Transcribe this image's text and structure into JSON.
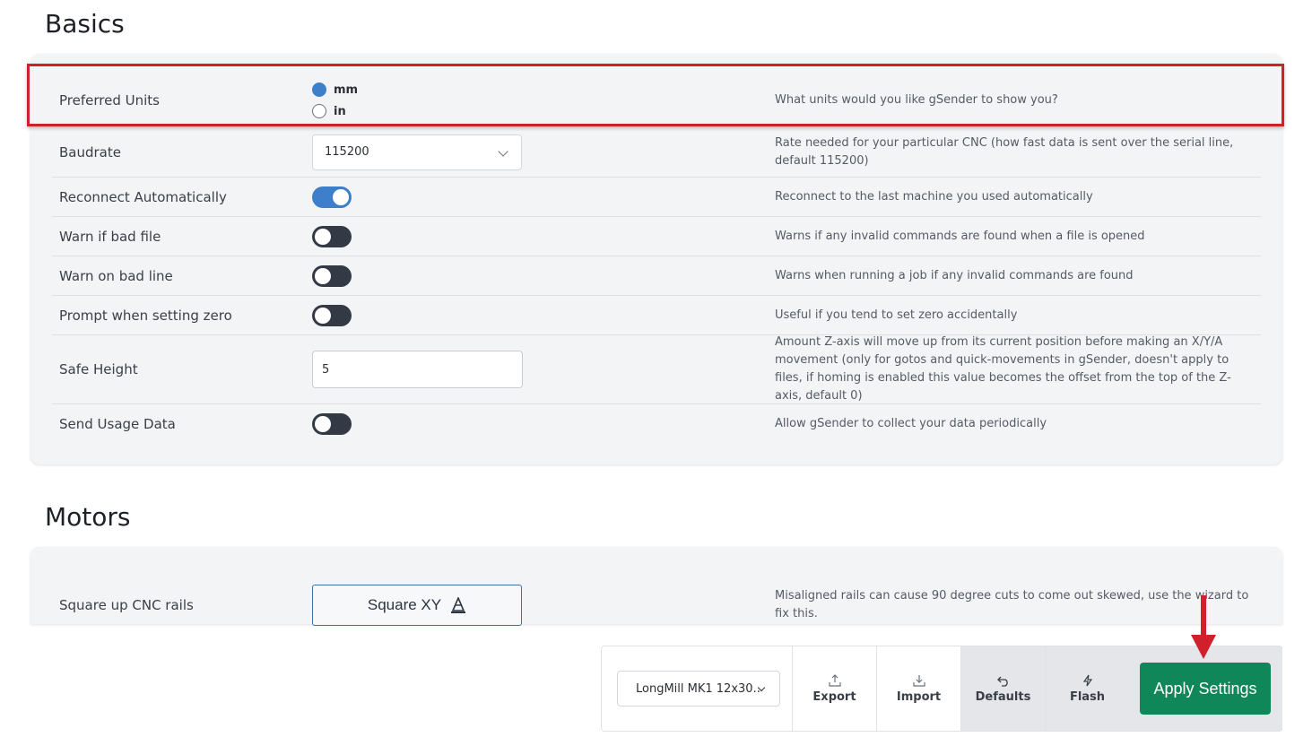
{
  "sections": {
    "basics_title": "Basics",
    "motors_title": "Motors"
  },
  "basics": {
    "preferred_units": {
      "label": "Preferred Units",
      "options": [
        "mm",
        "in"
      ],
      "selected": "mm",
      "description": "What units would you like gSender to show you?"
    },
    "baudrate": {
      "label": "Baudrate",
      "value": "115200",
      "description": "Rate needed for your particular CNC (how fast data is sent over the serial line, default 115200)"
    },
    "reconnect": {
      "label": "Reconnect Automatically",
      "on": true,
      "description": "Reconnect to the last machine you used automatically"
    },
    "warn_bad_file": {
      "label": "Warn if bad file",
      "on": false,
      "description": "Warns if any invalid commands are found when a file is opened"
    },
    "warn_bad_line": {
      "label": "Warn on bad line",
      "on": false,
      "description": "Warns when running a job if any invalid commands are found"
    },
    "prompt_zero": {
      "label": "Prompt when setting zero",
      "on": false,
      "description": "Useful if you tend to set zero accidentally"
    },
    "safe_height": {
      "label": "Safe Height",
      "value": "5",
      "description": "Amount Z-axis will move up from its current position before making an X/Y/A movement (only for gotos and quick-movements in gSender, doesn't apply to files, if homing is enabled this value becomes the offset from the top of the Z-axis, default 0)"
    },
    "usage_data": {
      "label": "Send Usage Data",
      "on": false,
      "description": "Allow gSender to collect your data periodically"
    }
  },
  "motors": {
    "square_up": {
      "label": "Square up CNC rails",
      "button_label": "Square XY",
      "description": "Misaligned rails can cause 90 degree cuts to come out skewed, use the wizard to fix this."
    }
  },
  "footer": {
    "profile": "LongMill MK1 12x30..",
    "export_label": "Export",
    "import_label": "Import",
    "defaults_label": "Defaults",
    "flash_label": "Flash",
    "apply_label": "Apply Settings"
  },
  "colors": {
    "accent": "#3e7fcb",
    "apply": "#0f8759",
    "highlight": "#d0202c"
  }
}
